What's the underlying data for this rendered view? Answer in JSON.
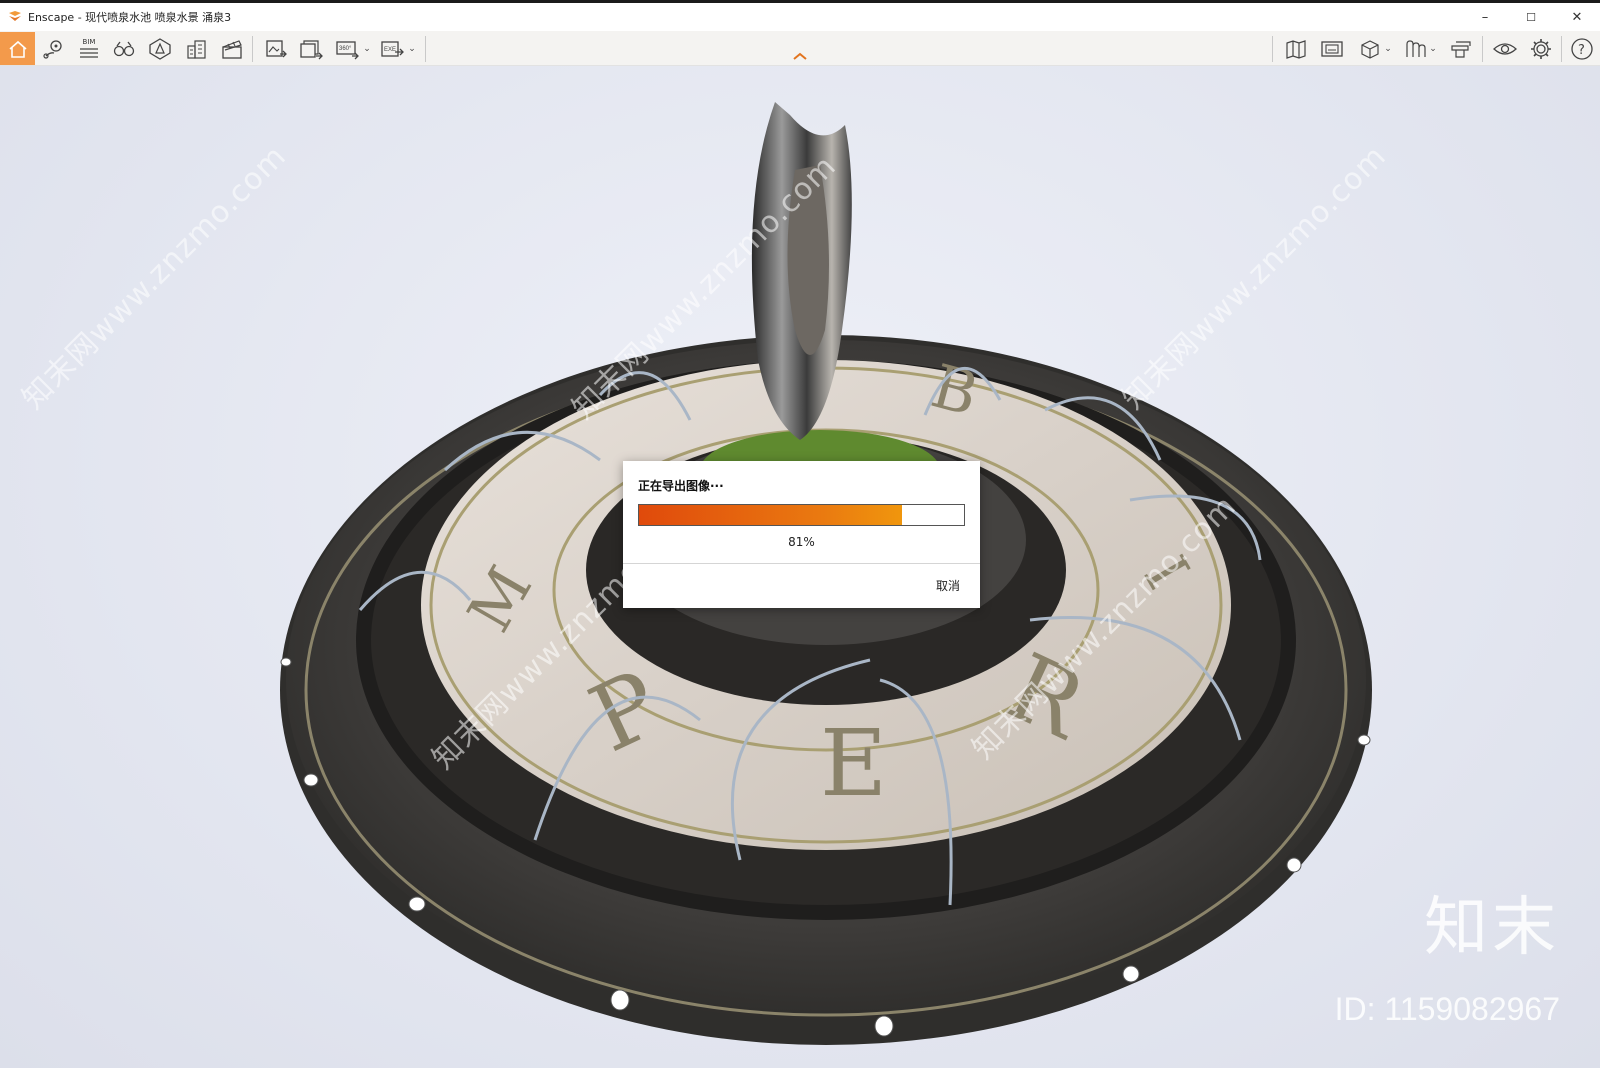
{
  "window": {
    "title": "Enscape - 现代喷泉水池 喷泉水景 涌泉3",
    "minimize": "–",
    "maximize": "☐",
    "close": "✕"
  },
  "toolbar": {
    "left_icons": [
      "home-icon",
      "location-icon",
      "bim-icon",
      "binoculars-icon",
      "asset-library-icon",
      "buildings-icon",
      "clapperboard-icon",
      "render-image-icon",
      "batch-render-icon",
      "panorama-360-icon",
      "export-exe-icon"
    ],
    "right_icons": [
      "map-icon",
      "capture-icon",
      "view-cube-icon",
      "atlas-icon",
      "collaboration-icon",
      "eye-icon",
      "settings-icon",
      "help-icon"
    ],
    "bim_label": "BIM",
    "pano_label": "360°",
    "exe_label": "EXE",
    "accent": "#f39a4b"
  },
  "viewport": {
    "watermark": "知末网www.znzmo.com",
    "brand": "知末",
    "id_text": "ID: 1159082967"
  },
  "dialog": {
    "title": "正在导出图像···",
    "progress": 0.81,
    "percent_label": "81%",
    "cancel": "取消",
    "bar_color": "#e04a0c"
  }
}
